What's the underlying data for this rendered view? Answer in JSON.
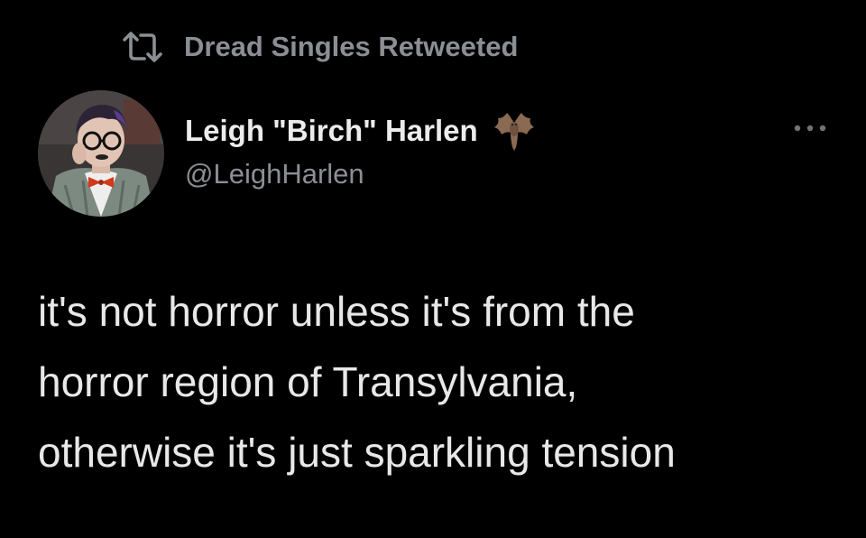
{
  "retweet": {
    "label": "Dread Singles Retweeted",
    "icon": "retweet-icon"
  },
  "author": {
    "display_name": "Leigh \"Birch\" Harlen",
    "handle": "@LeighHarlen",
    "name_emoji": "bat-icon",
    "avatar": "profile-avatar"
  },
  "actions": {
    "more_icon": "more-icon"
  },
  "tweet": {
    "lines": [
      "it's not horror unless it's from the",
      "horror region of Transylvania,",
      "otherwise it's just sparkling tension"
    ]
  },
  "colors": {
    "background": "#000000",
    "primary_text": "#e7e9ea",
    "secondary_text": "#8b8f94"
  }
}
